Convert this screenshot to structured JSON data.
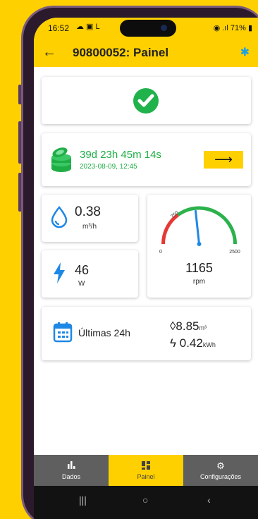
{
  "status_bar": {
    "time": "16:52",
    "left_icons": "☁ ▣ L",
    "right": "71%"
  },
  "app_bar": {
    "title": "90800052: Painel",
    "back_icon": "arrow-back",
    "bluetooth_icon": "bluetooth"
  },
  "status_card": {
    "icon": "check-circle"
  },
  "runtime_card": {
    "duration": "39d 23h 45m 14s",
    "since": "2023-08-09, 12:45",
    "button_label": "⟶"
  },
  "flow_card": {
    "value": "0.38",
    "unit": "m³/h"
  },
  "power_card": {
    "value": "46",
    "unit": "W"
  },
  "gauge_card": {
    "value": "1165",
    "unit": "rpm",
    "min_label": "0",
    "max_label": "2500",
    "threshold_label": "750",
    "level": 1165,
    "min": 0,
    "max": 2500,
    "threshold": 750,
    "colors": {
      "low": "#e53935",
      "high": "#2bb24c",
      "needle": "#1e88e5"
    }
  },
  "last24_card": {
    "label": "Últimas 24h",
    "volume_value": "8.85",
    "volume_unit": "m³",
    "energy_value": "0.42",
    "energy_unit": "kWh"
  },
  "bottom_nav": {
    "items": [
      {
        "label": "Dados",
        "icon": "bar-chart"
      },
      {
        "label": "Painel",
        "icon": "dashboard"
      },
      {
        "label": "Configurações",
        "icon": "gear"
      }
    ],
    "active": "Painel"
  },
  "system_nav": {
    "recents": "|||",
    "home": "○",
    "back": "‹"
  },
  "colors": {
    "accent": "#FFD000",
    "ok_green": "#20b24b",
    "text_green": "#1fae46",
    "icon_blue": "#1e88e5"
  }
}
